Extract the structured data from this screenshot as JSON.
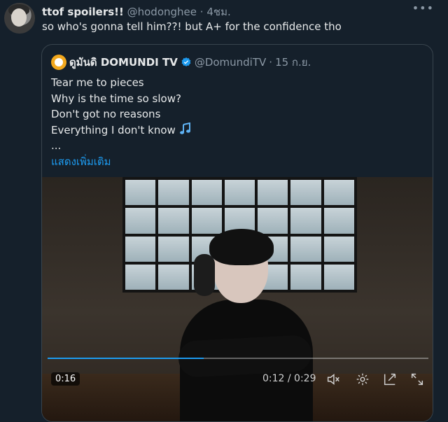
{
  "tweet": {
    "author_name": "ttof spoilers!!",
    "author_handle": "@hodonghee",
    "separator": "·",
    "time": "4ชม.",
    "text": "so who's gonna tell him??! but A+ for the confidence tho"
  },
  "quote": {
    "author_name": "ดูมันดิ DOMUNDI TV",
    "author_handle": "@DomundiTV",
    "separator": "·",
    "date": "15 ก.ย.",
    "lines": [
      "Tear me to pieces",
      "Why is the time so slow?",
      "Don't got no reasons",
      "Everything I don't know"
    ],
    "ellipsis": "...",
    "show_more": "แสดงเพิ่มเติม"
  },
  "video": {
    "remaining": "0:16",
    "time_display": "0:12 / 0:29",
    "progress": 0.41
  },
  "icons": {
    "more": "more-horizontal-icon",
    "verified": "verified-badge-icon",
    "music": "music-notes-icon",
    "mute": "volume-muted-icon",
    "settings": "gear-icon",
    "pip": "picture-in-picture-icon",
    "fullscreen": "fullscreen-icon"
  },
  "colors": {
    "background": "#15202b",
    "accent": "#1d9bf0",
    "muted": "#8b98a5"
  }
}
